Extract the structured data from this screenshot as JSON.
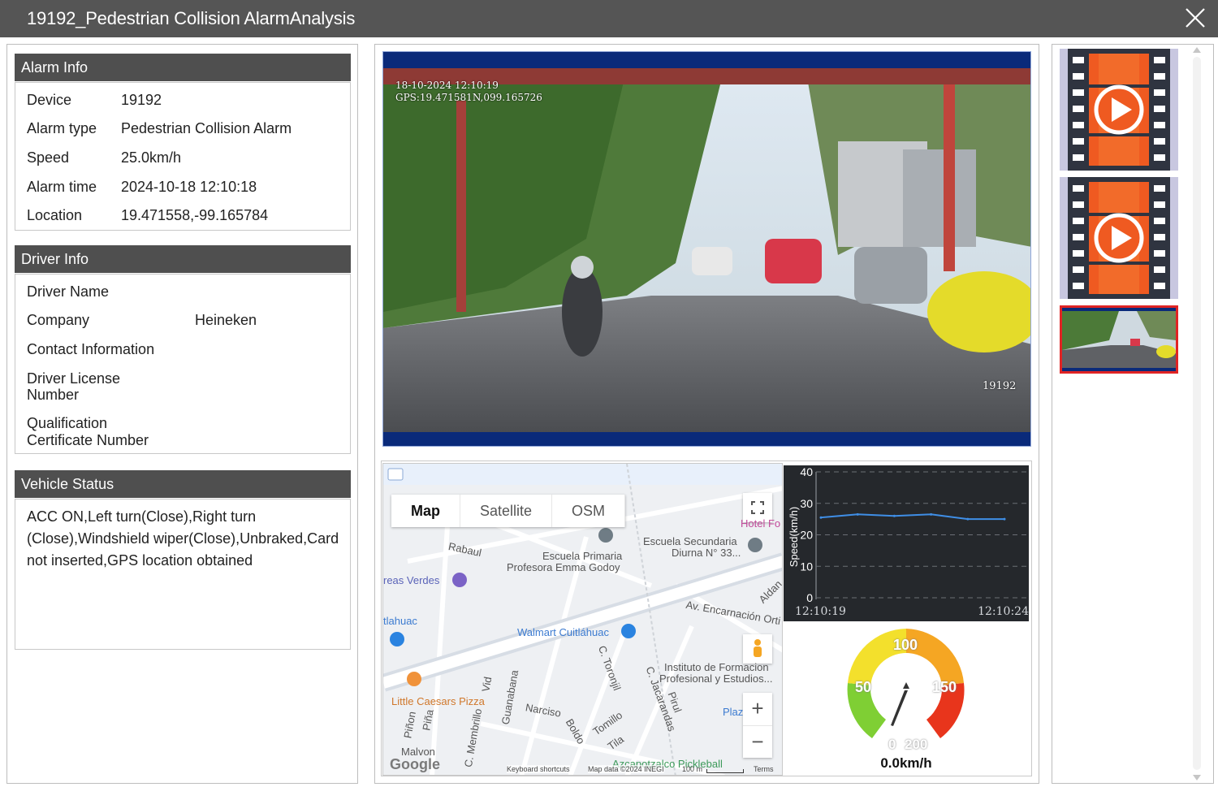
{
  "window": {
    "title": "19192_Pedestrian Collision AlarmAnalysis",
    "close_icon": "close-icon"
  },
  "alarm_info": {
    "header": "Alarm Info",
    "rows": [
      {
        "label": "Device",
        "value": "19192"
      },
      {
        "label": "Alarm type",
        "value": "Pedestrian Collision Alarm"
      },
      {
        "label": "Speed",
        "value": "25.0km/h"
      },
      {
        "label": "Alarm time",
        "value": "2024-10-18 12:10:18"
      },
      {
        "label": "Location",
        "value": "19.471558,-99.165784"
      }
    ]
  },
  "driver_info": {
    "header": "Driver Info",
    "driver_name_label": "Driver Name",
    "driver_name_value": "",
    "company_label": "Company",
    "company_value": "Heineken",
    "contact_label": "Contact Information",
    "contact_value": "",
    "license_label_1": "Driver License",
    "license_label_2": "Number",
    "license_value": "",
    "qualification_label_1": "Qualification",
    "qualification_label_2": "Certificate Number",
    "qualification_value": ""
  },
  "vehicle_status": {
    "header": "Vehicle Status",
    "text": "ACC ON,Left turn(Close),Right turn (Close),Windshield wiper(Close),Unbraked,Card not inserted,GPS location obtained"
  },
  "video": {
    "overlay_date": "18-10-2024 12:10:19",
    "overlay_gps": "GPS:19.471581N,099.165726",
    "overlay_id": "19192"
  },
  "map": {
    "tabs": [
      "Map",
      "Satellite",
      "OSM"
    ],
    "active_tab": "Map",
    "labels": {
      "rabaul": "Rabaul",
      "escuela_primaria_1": "Escuela Primaria",
      "escuela_primaria_2": "Profesora Emma Godoy",
      "escuela_secundaria_1": "Escuela Secundaria",
      "escuela_secundaria_2": "Diurna N° 33...",
      "areas_verdes": "reas Verdes",
      "tlahuac": "tlahuac",
      "walmart": "Walmart Cuitláhuac",
      "av_encarnacion": "Av. Encarnación Orti",
      "aldan": "Aldan",
      "instituto_1": "Instituto de Formacion",
      "instituto_2": "Profesional y Estudios...",
      "little_caesars": "Little Caesars Pizza",
      "narciso": "Narciso",
      "boldo": "Boldo",
      "tomillo": "Tomillo",
      "tila": "Tila",
      "toronjil": "C. Toronjil",
      "jacarandas": "C. Jacarandas",
      "pirul": "Pirul",
      "guanabana": "Guanabana",
      "vid": "Vid",
      "membrillo": "C. Membrillo",
      "pinon": "Piñon",
      "pina": "Piña",
      "malvon": "Malvon",
      "hotel": "Hotel Fo",
      "plaza": "Plaz",
      "azcapotzalco": "Azcapotzalco Pickleball",
      "google": "Google",
      "keyboard": "Keyboard shortcuts",
      "mapdata": "Map data ©2024 INEGI",
      "scale": "100 m",
      "terms": "Terms"
    },
    "zoom_in": "+",
    "zoom_out": "−"
  },
  "chart_data": {
    "type": "line",
    "x": [
      "12:10:19",
      "12:10:20",
      "12:10:21",
      "12:10:22",
      "12:10:23",
      "12:10:24"
    ],
    "series": [
      {
        "values": [
          25.5,
          26.5,
          26.0,
          26.5,
          25.0,
          25.0
        ]
      }
    ],
    "ylabel": "Speed(km/h)",
    "ylim": [
      0,
      40
    ],
    "yticks": [
      0,
      10,
      20,
      30,
      40
    ],
    "xtick_labels": [
      "12:10:19",
      "12:10:24"
    ],
    "grid": true,
    "colors": {
      "line": "#3f8ee6",
      "background": "#25282c",
      "grid": "#6b6f75"
    }
  },
  "gauge": {
    "value": 0.0,
    "readout": "0.0km/h",
    "labels": [
      "0",
      "50",
      "100",
      "150",
      "200"
    ],
    "colors": {
      "green": "#7fcf34",
      "yellow": "#f3e02c",
      "orange": "#f5a623",
      "red": "#e8351c"
    }
  },
  "thumbnails": [
    {
      "type": "video",
      "icon": "video-play-icon"
    },
    {
      "type": "video",
      "icon": "video-play-icon"
    },
    {
      "type": "image",
      "icon": "snapshot-image",
      "selected": true
    }
  ]
}
